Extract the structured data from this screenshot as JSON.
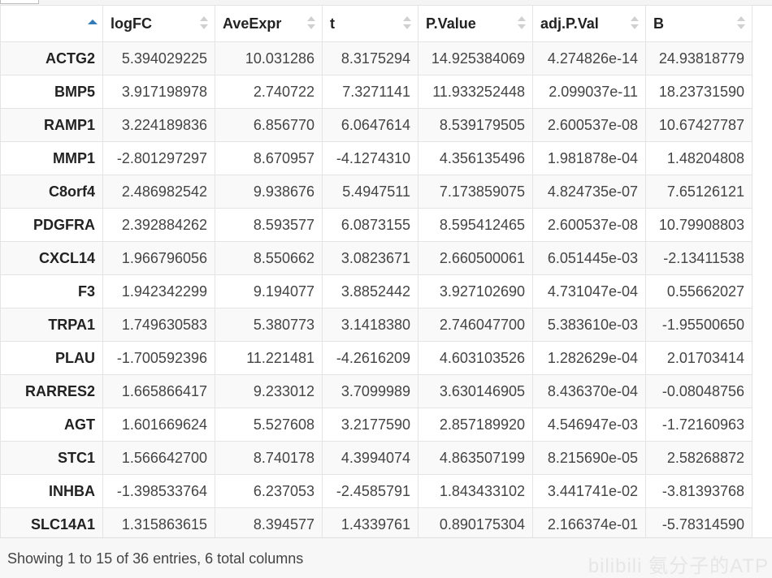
{
  "table": {
    "headers": [
      "",
      "logFC",
      "AveExpr",
      "t",
      "P.Value",
      "adj.P.Val",
      "B"
    ],
    "rows": [
      [
        "ACTG2",
        "5.394029225",
        "10.031286",
        "8.3175294",
        "14.925384069",
        "4.274826e-14",
        "24.93818779"
      ],
      [
        "BMP5",
        "3.917198978",
        "2.740722",
        "7.3271141",
        "11.933252448",
        "2.099037e-11",
        "18.23731590"
      ],
      [
        "RAMP1",
        "3.224189836",
        "6.856770",
        "6.0647614",
        "8.539179505",
        "2.600537e-08",
        "10.67427787"
      ],
      [
        "MMP1",
        "-2.801297297",
        "8.670957",
        "-4.1274310",
        "4.356135496",
        "1.981878e-04",
        "1.48204808"
      ],
      [
        "C8orf4",
        "2.486982542",
        "9.938676",
        "5.4947511",
        "7.173859075",
        "4.824735e-07",
        "7.65126121"
      ],
      [
        "PDGFRA",
        "2.392884262",
        "8.593577",
        "6.0873155",
        "8.595412465",
        "2.600537e-08",
        "10.79908803"
      ],
      [
        "CXCL14",
        "1.966796056",
        "8.550662",
        "3.0823671",
        "2.660500061",
        "6.051445e-03",
        "-2.13411538"
      ],
      [
        "F3",
        "1.942342299",
        "9.194077",
        "3.8852442",
        "3.927102690",
        "4.731047e-04",
        "0.55662027"
      ],
      [
        "TRPA1",
        "1.749630583",
        "5.380773",
        "3.1418380",
        "2.746047700",
        "5.383610e-03",
        "-1.95500650"
      ],
      [
        "PLAU",
        "-1.700592396",
        "11.221481",
        "-4.2616209",
        "4.603103526",
        "1.282629e-04",
        "2.01703414"
      ],
      [
        "RARRES2",
        "1.665866417",
        "9.233012",
        "3.7099989",
        "3.630146905",
        "8.436370e-04",
        "-0.08048756"
      ],
      [
        "AGT",
        "1.601669624",
        "5.527608",
        "3.2177590",
        "2.857189920",
        "4.546947e-03",
        "-1.72160963"
      ],
      [
        "STC1",
        "1.566642700",
        "8.740178",
        "4.3994074",
        "4.863507199",
        "8.215690e-05",
        "2.58268872"
      ],
      [
        "INHBA",
        "-1.398533764",
        "6.237053",
        "-2.4585791",
        "1.843433102",
        "3.441741e-02",
        "-3.81393768"
      ],
      [
        "SLC14A1",
        "1.315863615",
        "8.394577",
        "1.4339761",
        "0.890175304",
        "2.166374e-01",
        "-5.78314590"
      ]
    ]
  },
  "footer": {
    "info": "Showing 1 to 15 of 36 entries, 6 total columns",
    "watermark": "bilibili 氨分子的ATP"
  },
  "colors": {
    "sort_active": "#337ab7",
    "stripe": "#f9f9f9",
    "border": "#e4e4e4"
  }
}
